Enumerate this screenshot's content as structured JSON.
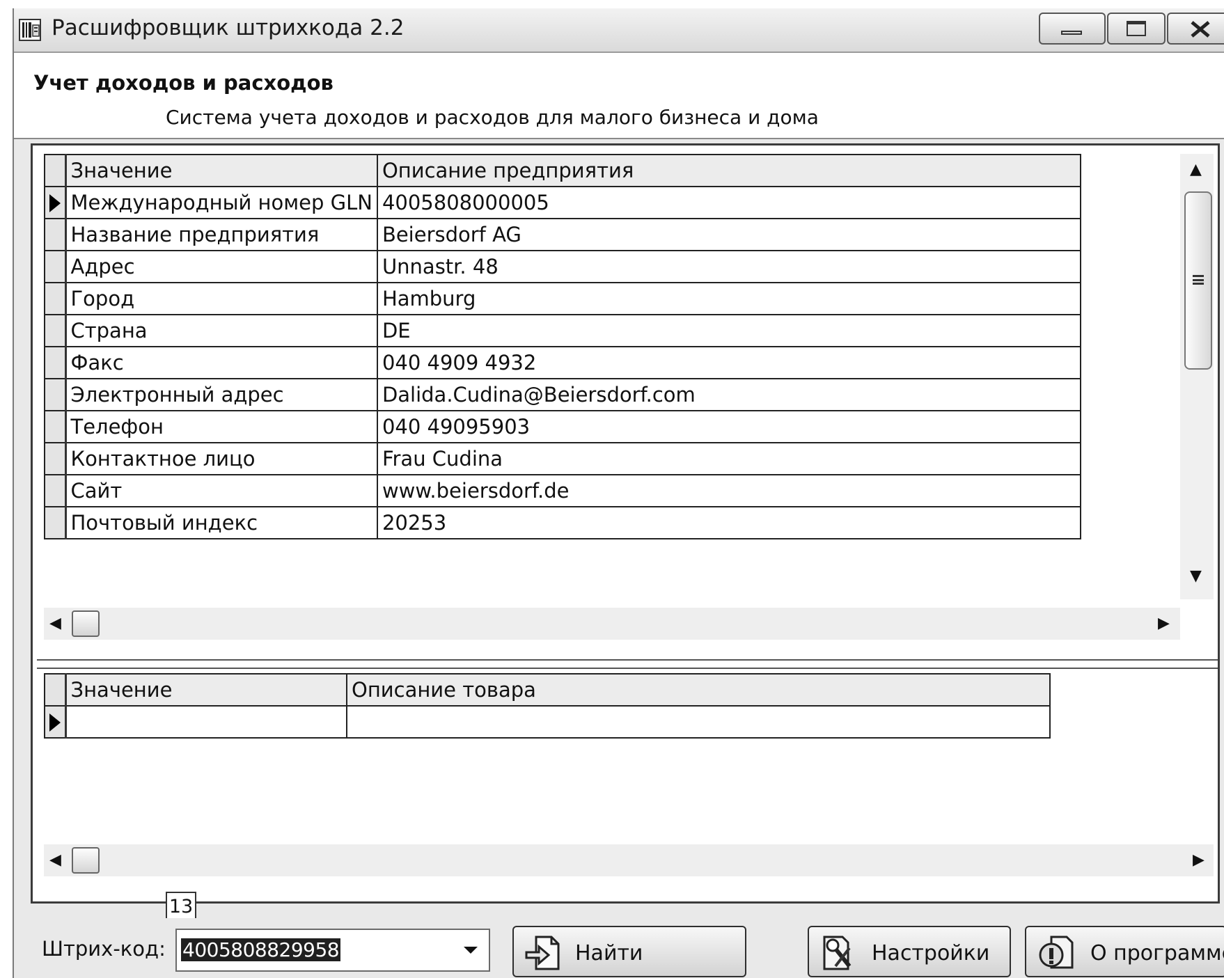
{
  "window": {
    "title": "Расшифровщик штрихкода 2.2",
    "header_title": "Учет доходов и расходов",
    "header_subtitle": "Система учета доходов и расходов для малого бизнеса и дома"
  },
  "company_grid": {
    "columns": [
      "Значение",
      "Описание предприятия"
    ],
    "rows": [
      {
        "field": "Международный номер GLN",
        "value": "4005808000005"
      },
      {
        "field": "Название предприятия",
        "value": "Beiersdorf AG"
      },
      {
        "field": "Адрес",
        "value": "Unnastr. 48"
      },
      {
        "field": "Город",
        "value": "Hamburg"
      },
      {
        "field": "Страна",
        "value": "DE"
      },
      {
        "field": "Факс",
        "value": "040 4909 4932"
      },
      {
        "field": "Электронный адрес",
        "value": "Dalida.Cudina@Beiersdorf.com"
      },
      {
        "field": "Телефон",
        "value": "040 49095903"
      },
      {
        "field": "Контактное лицо",
        "value": "Frau Cudina"
      },
      {
        "field": "Сайт",
        "value": "www.beiersdorf.de"
      },
      {
        "field": "Почтовый индекс",
        "value": "20253"
      }
    ]
  },
  "product_grid": {
    "columns": [
      "Значение",
      "Описание товара"
    ],
    "rows": [
      {
        "field": "",
        "value": ""
      }
    ]
  },
  "barcode": {
    "label": "Штрих-код:",
    "value": "4005808829958",
    "length_hint": "13"
  },
  "buttons": {
    "find": "Найти",
    "settings": "Настройки",
    "about": "О программе"
  },
  "icons": {
    "app": "barcode-app-icon",
    "find": "find-document-icon",
    "settings": "settings-tools-icon",
    "about": "about-info-icon"
  }
}
